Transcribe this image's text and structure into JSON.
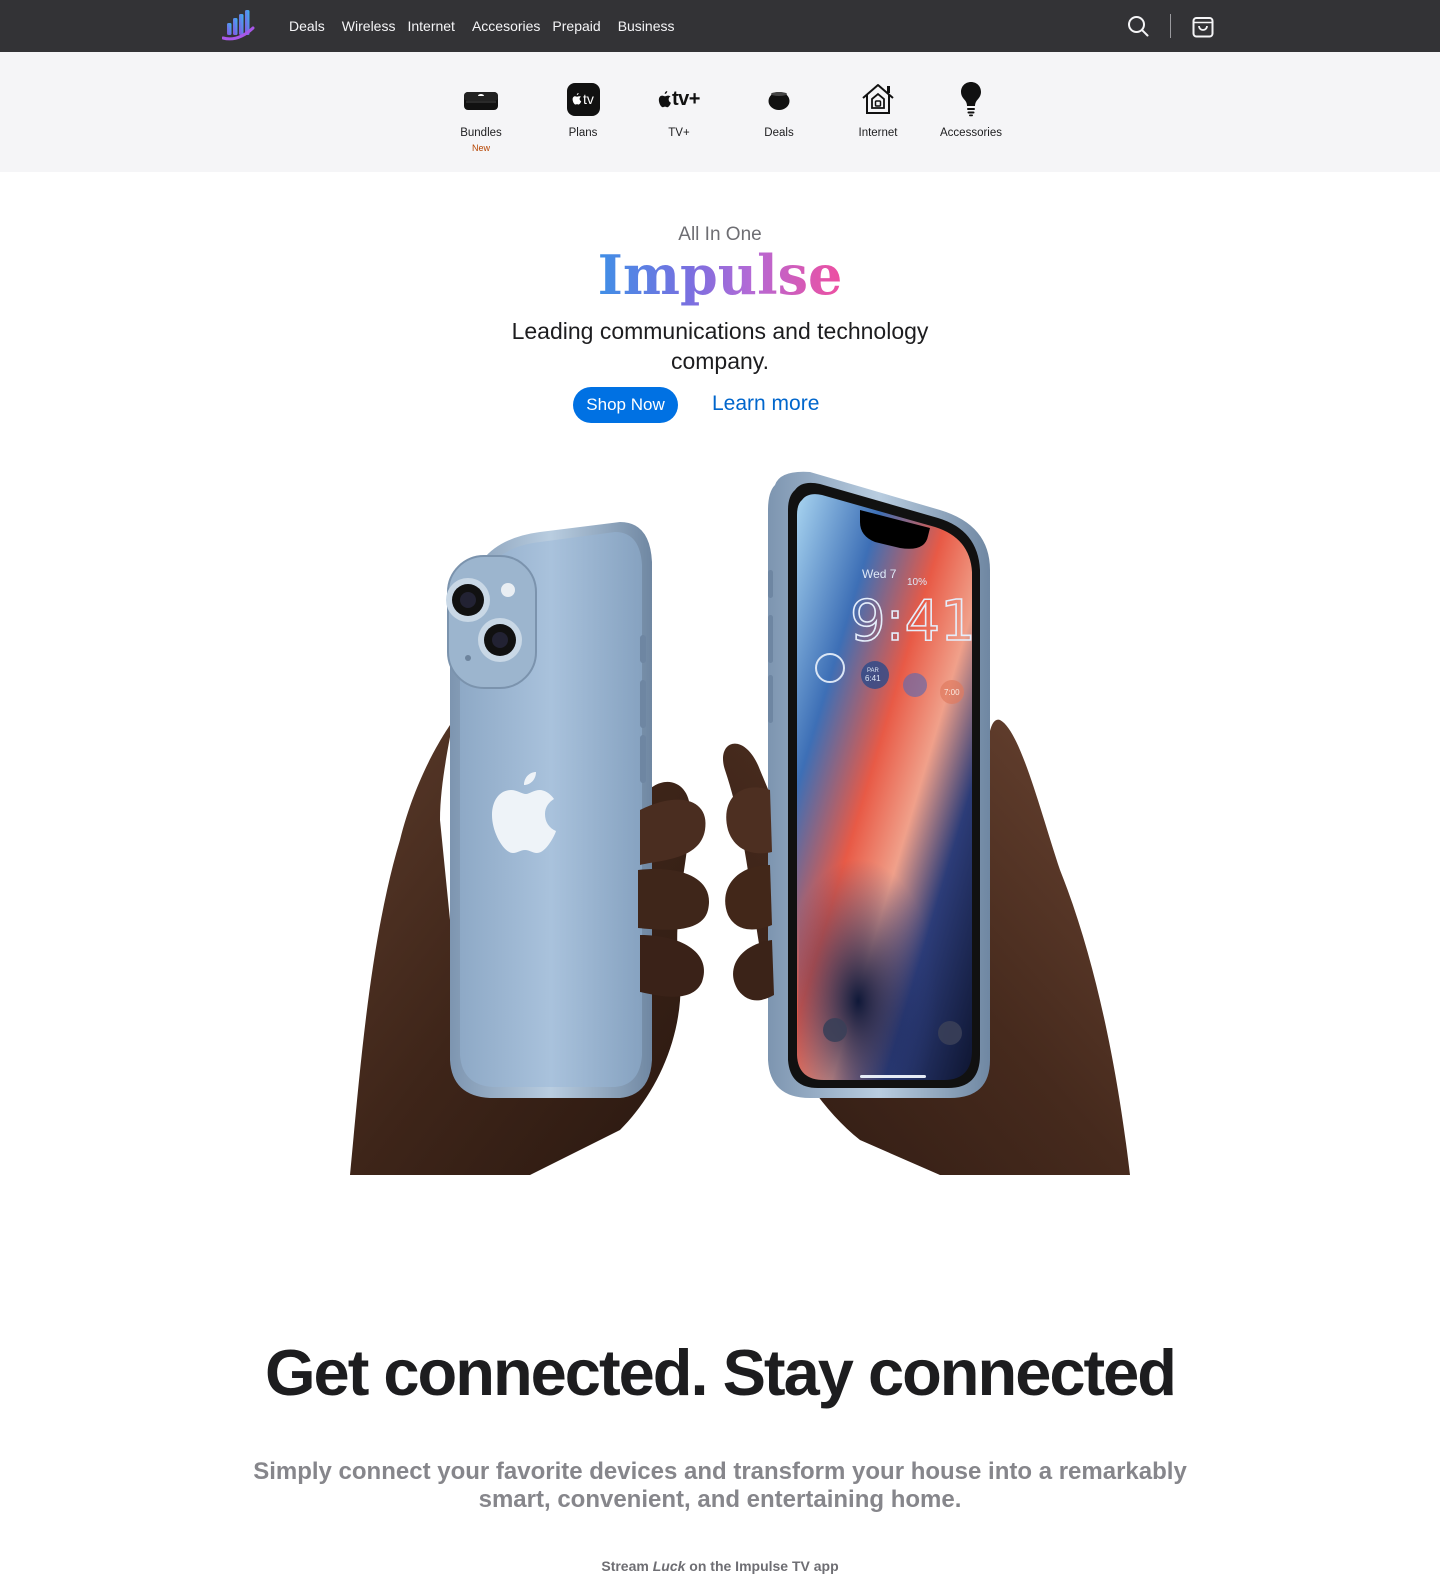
{
  "nav": {
    "links": [
      "Deals",
      "Wireless",
      "Internet",
      "Accesories",
      "Prepaid",
      "Business"
    ],
    "icons": {
      "logo": "bar-chart-logo-icon",
      "search": "search-icon",
      "bag": "shopping-bag-icon"
    },
    "background": "#333336"
  },
  "categories": [
    {
      "label": "Bundles",
      "badge": "New",
      "icon": "set-top-box-icon"
    },
    {
      "label": "Plans",
      "icon": "apple-tv-app-icon"
    },
    {
      "label": "TV+",
      "icon": "apple-tv-plus-wordmark",
      "wordmark": "tv+"
    },
    {
      "label": "Deals",
      "icon": "homepod-mini-icon"
    },
    {
      "label": "Internet",
      "icon": "home-icon"
    },
    {
      "label": "Accessories",
      "icon": "lightbulb-icon"
    }
  ],
  "plans_icon_text": "tv",
  "hero": {
    "eyebrow": "All In One",
    "brand": "Impulse",
    "tagline": "Leading communications and technology company.",
    "primary_cta": "Shop Now",
    "secondary_cta": "Learn more",
    "accent_color": "#0071e3",
    "phone_screen": {
      "date": "Wed 7",
      "weather": "10%",
      "time": "9:41",
      "widget_1": "PAR",
      "widget_2": "6:41",
      "widget_3": "7:00"
    }
  },
  "section": {
    "headline": "Get connected. Stay connected",
    "subcopy": "Simply connect your favorite devices and transform your house into a remarkably smart, convenient, and entertaining home.",
    "stream_prefix": "Stream ",
    "stream_title": "Luck",
    "stream_suffix": " on the Impulse TV app"
  }
}
